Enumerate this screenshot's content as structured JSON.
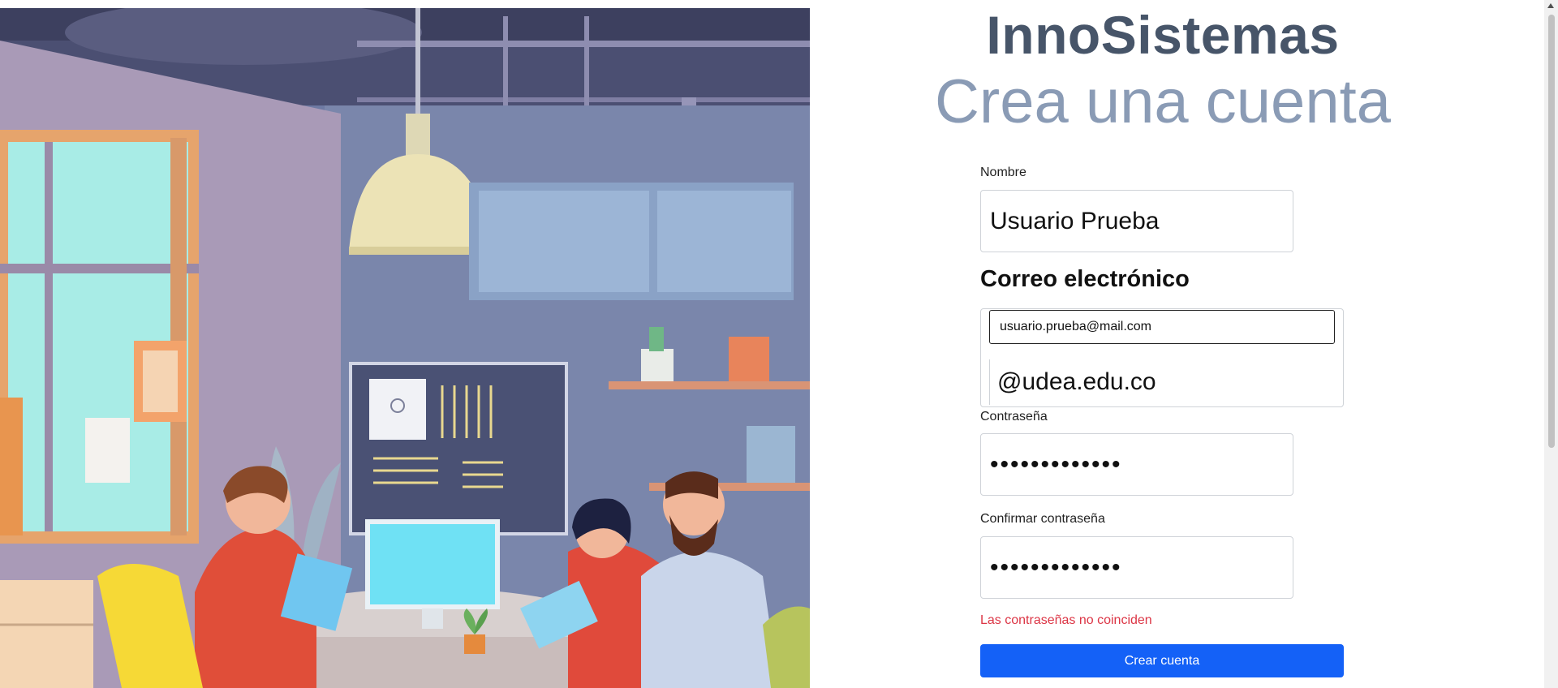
{
  "brand": {
    "name": "InnoSistemas"
  },
  "page": {
    "subtitle": "Crea una cuenta"
  },
  "form": {
    "name_label": "Nombre",
    "name_value": "Usuario Prueba",
    "email_label": "Correo electrónico",
    "email_value": "usuario.prueba@mail.com",
    "email_domain": "@udea.edu.co",
    "password_label": "Contraseña",
    "password_value": "•••••••••••••",
    "confirm_label": "Confirmar contraseña",
    "confirm_value": "•••••••••••••",
    "error_message": "Las contraseñas no coinciden",
    "submit_label": "Crear cuenta"
  },
  "colors": {
    "brand_text": "#475569",
    "subtitle_text": "#8a9bb5",
    "error": "#dc3545",
    "primary_button": "#1461f7"
  },
  "icons": {
    "illustration": "coworking-illustration"
  }
}
